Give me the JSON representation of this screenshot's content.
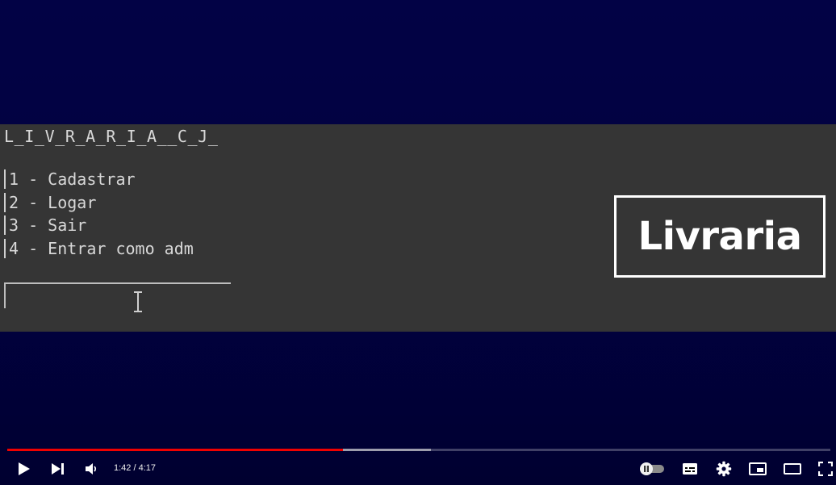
{
  "console": {
    "title": "L_I_V_R_A_R_I_A__C_J_",
    "menu": [
      {
        "label": "1 - Cadastrar"
      },
      {
        "label": "2 - Logar"
      },
      {
        "label": "3 - Sair"
      },
      {
        "label": "4 - Entrar como adm"
      }
    ],
    "input_value": ""
  },
  "logo": {
    "text": "Livraria"
  },
  "player": {
    "time": "1:42 / 4:17",
    "progress_played": 0.408,
    "progress_buffered": 0.515,
    "autoplay": "off",
    "accent_color": "#f00000",
    "icons": [
      "play-icon",
      "next-icon",
      "volume-icon",
      "autoplay-toggle-icon",
      "subtitles-icon",
      "gear-icon",
      "miniplayer-icon",
      "theater-mode-icon",
      "fullscreen-icon"
    ]
  },
  "colors": {
    "background": "#01013f",
    "console_bg": "#353535",
    "console_text": "#d8d8d8"
  }
}
